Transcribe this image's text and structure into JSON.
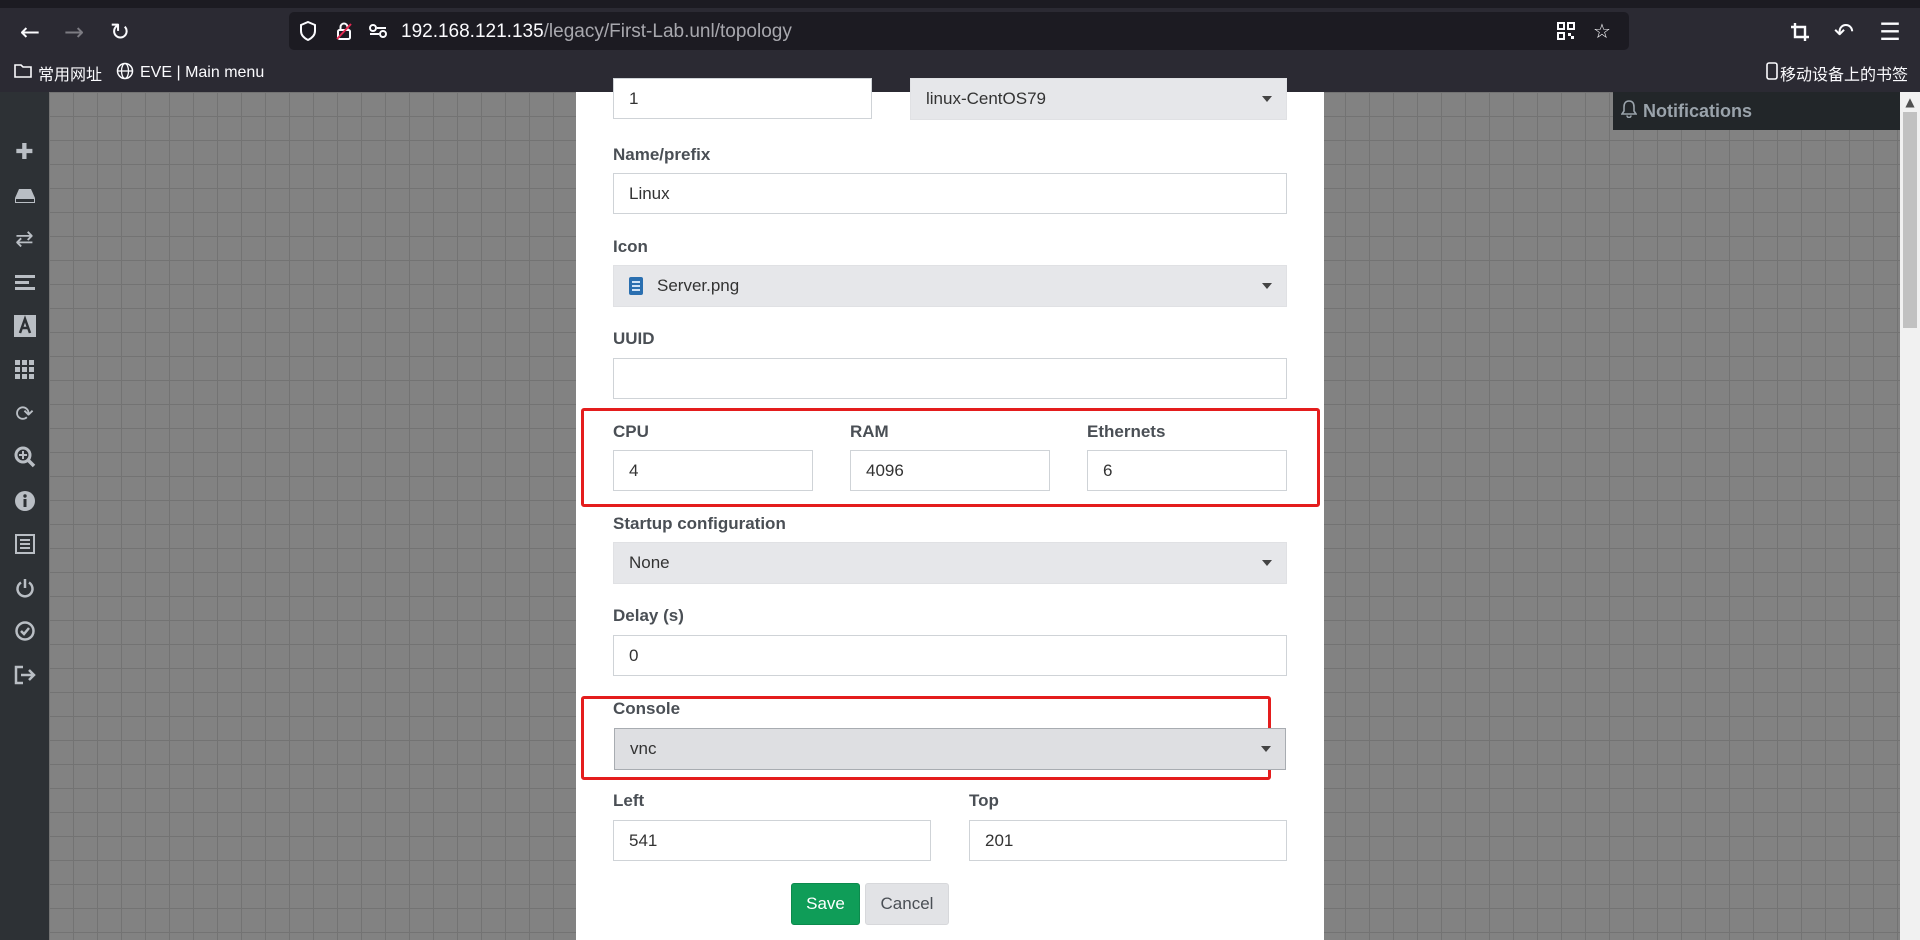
{
  "browser": {
    "url_host": "192.168.121.135",
    "url_path": "/legacy/First-Lab.unl/topology",
    "icons": {
      "back": "back-arrow-icon",
      "forward": "forward-arrow-icon",
      "reload": "reload-icon",
      "shield": "tracking-protection-icon",
      "lock": "insecure-lock-icon",
      "permissions": "permissions-icon",
      "qr": "qr-code-icon",
      "bookmark": "bookmark-star-icon",
      "crop": "screenshot-crop-icon",
      "undo": "undo-icon",
      "menu": "hamburger-menu-icon"
    }
  },
  "bookmarks": {
    "items": [
      {
        "label": "常用网址",
        "icon": "folder-icon"
      },
      {
        "label": "EVE | Main menu",
        "icon": "globe-icon"
      }
    ],
    "mobile": {
      "label": "移动设备上的书签",
      "icon": "mobile-device-icon"
    }
  },
  "sidebar": {
    "icons": [
      "add-icon",
      "node-icon",
      "network-icon",
      "list-icon",
      "text-icon",
      "grid-icon",
      "refresh-icon",
      "zoom-icon",
      "info-icon",
      "notes-icon",
      "power-icon",
      "checkmark-icon",
      "logout-icon"
    ]
  },
  "notifications": {
    "title": "Notifications",
    "icon": "bell-icon"
  },
  "form": {
    "number": {
      "value": "1"
    },
    "template": {
      "value": "linux-CentOS79"
    },
    "name_prefix": {
      "label": "Name/prefix",
      "value": "Linux"
    },
    "icon": {
      "label": "Icon",
      "value": "Server.png",
      "icon": "server-file-icon"
    },
    "uuid": {
      "label": "UUID",
      "value": ""
    },
    "cpu": {
      "label": "CPU",
      "value": "4"
    },
    "ram": {
      "label": "RAM",
      "value": "4096"
    },
    "ethernets": {
      "label": "Ethernets",
      "value": "6"
    },
    "startup": {
      "label": "Startup configuration",
      "value": "None"
    },
    "delay": {
      "label": "Delay (s)",
      "value": "0"
    },
    "console": {
      "label": "Console",
      "value": "vnc"
    },
    "left": {
      "label": "Left",
      "value": "541"
    },
    "top": {
      "label": "Top",
      "value": "201"
    },
    "save_label": "Save",
    "cancel_label": "Cancel"
  },
  "colors": {
    "highlight": "#e41d1d",
    "save_button": "#0f9d58",
    "sidebar": "#2d3135",
    "browser_chrome": "#2b2a33"
  }
}
